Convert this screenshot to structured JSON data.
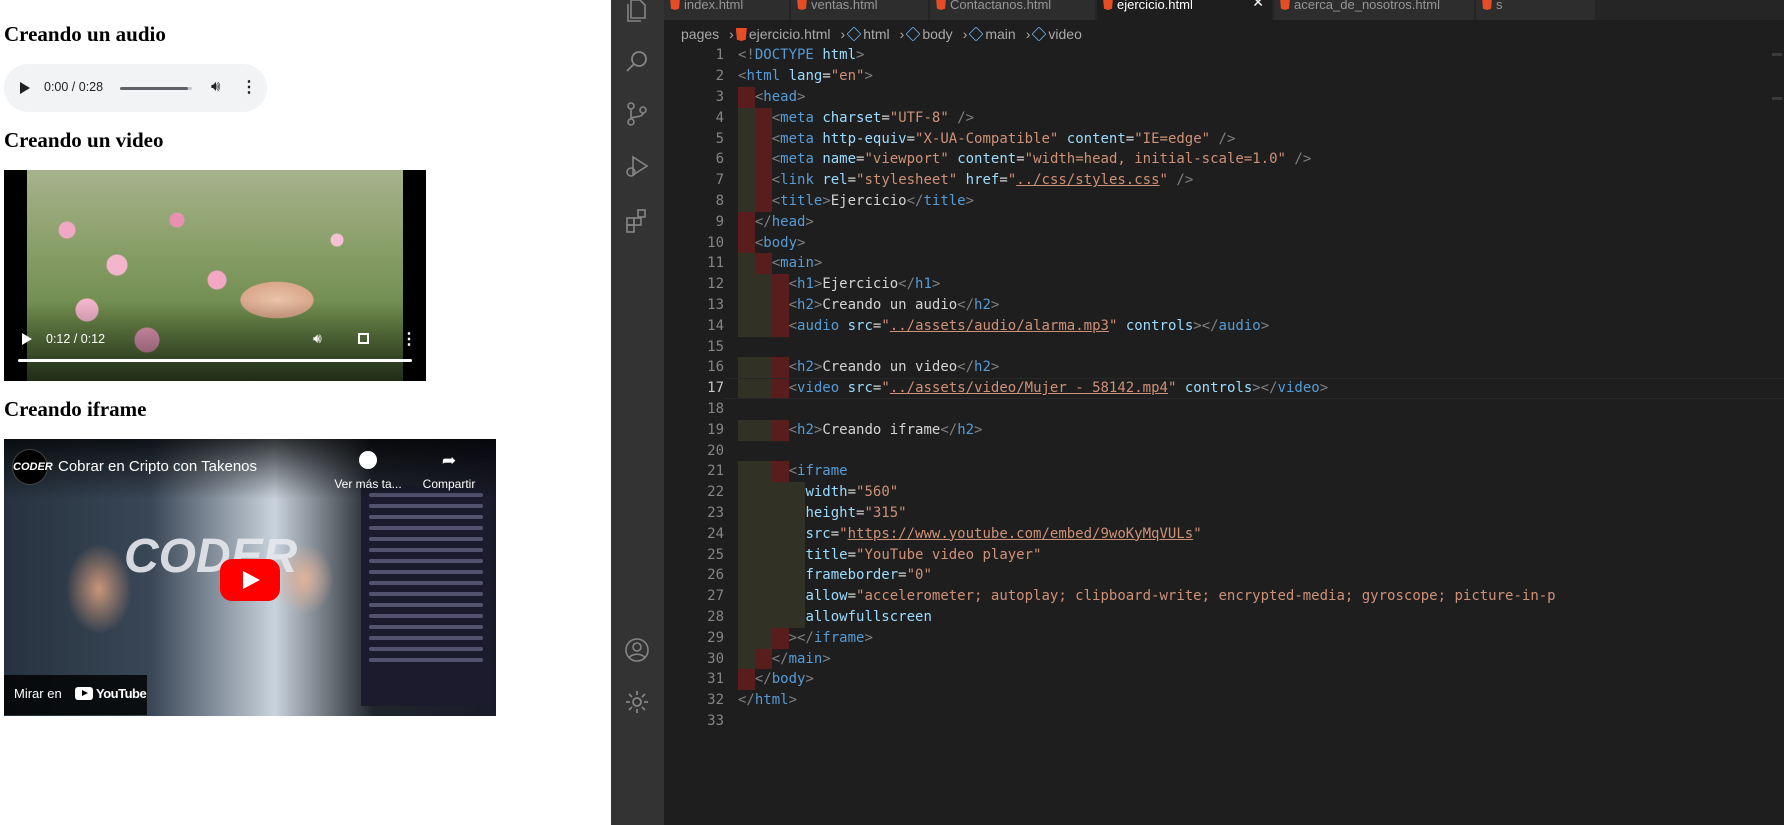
{
  "preview": {
    "audio_heading": "Creando un audio",
    "audio": {
      "time": "0:00 / 0:28",
      "progress": 0.95
    },
    "video_heading": "Creando un video",
    "video": {
      "time": "0:12 / 0:12",
      "progress": 1.0
    },
    "iframe_heading": "Creando iframe",
    "iframe": {
      "channel_logo": "CODER",
      "video_title": "Cobrar en Cripto con Takenos",
      "watch_later": "Ver más ta...",
      "share": "Compartir",
      "watch_on": "Mirar en",
      "youtube_label": "YouTube",
      "scene_text": "CODER"
    }
  },
  "editor": {
    "tabs": [
      {
        "label": "index.html",
        "active": false
      },
      {
        "label": "ventas.html",
        "active": false
      },
      {
        "label": "Contactanos.html",
        "active": false
      },
      {
        "label": "ejercicio.html",
        "active": true
      },
      {
        "label": "acerca_de_nosotros.html",
        "active": false
      },
      {
        "label": "s",
        "active": false
      }
    ],
    "breadcrumb": [
      "pages",
      "ejercicio.html",
      "html",
      "body",
      "main",
      "video"
    ],
    "current_line": 17,
    "lines": [
      [
        [
          "br",
          "<!"
        ],
        [
          "tag",
          "DOCTYPE"
        ],
        [
          "tx",
          " "
        ],
        [
          "at",
          "html"
        ],
        [
          "br",
          ">"
        ]
      ],
      [
        [
          "br",
          "<"
        ],
        [
          "tag",
          "html"
        ],
        [
          "tx",
          " "
        ],
        [
          "at",
          "lang"
        ],
        [
          "tx",
          "="
        ],
        [
          "sv",
          "\"en\""
        ],
        [
          "br",
          ">"
        ]
      ],
      [
        [
          "tx",
          "  "
        ],
        [
          "br",
          "<"
        ],
        [
          "tag",
          "head"
        ],
        [
          "br",
          ">"
        ]
      ],
      [
        [
          "tx",
          "    "
        ],
        [
          "br",
          "<"
        ],
        [
          "tag",
          "meta"
        ],
        [
          "tx",
          " "
        ],
        [
          "at",
          "charset"
        ],
        [
          "tx",
          "="
        ],
        [
          "sv",
          "\"UTF-8\""
        ],
        [
          "tx",
          " "
        ],
        [
          "br",
          "/>"
        ]
      ],
      [
        [
          "tx",
          "    "
        ],
        [
          "br",
          "<"
        ],
        [
          "tag",
          "meta"
        ],
        [
          "tx",
          " "
        ],
        [
          "at",
          "http-equiv"
        ],
        [
          "tx",
          "="
        ],
        [
          "sv",
          "\"X-UA-Compatible\""
        ],
        [
          "tx",
          " "
        ],
        [
          "at",
          "content"
        ],
        [
          "tx",
          "="
        ],
        [
          "sv",
          "\"IE=edge\""
        ],
        [
          "tx",
          " "
        ],
        [
          "br",
          "/>"
        ]
      ],
      [
        [
          "tx",
          "    "
        ],
        [
          "br",
          "<"
        ],
        [
          "tag",
          "meta"
        ],
        [
          "tx",
          " "
        ],
        [
          "at",
          "name"
        ],
        [
          "tx",
          "="
        ],
        [
          "sv",
          "\"viewport\""
        ],
        [
          "tx",
          " "
        ],
        [
          "at",
          "content"
        ],
        [
          "tx",
          "="
        ],
        [
          "sv",
          "\"width=head, initial-scale=1.0\""
        ],
        [
          "tx",
          " "
        ],
        [
          "br",
          "/>"
        ]
      ],
      [
        [
          "tx",
          "    "
        ],
        [
          "br",
          "<"
        ],
        [
          "tag",
          "link"
        ],
        [
          "tx",
          " "
        ],
        [
          "at",
          "rel"
        ],
        [
          "tx",
          "="
        ],
        [
          "sv",
          "\"stylesheet\""
        ],
        [
          "tx",
          " "
        ],
        [
          "at",
          "href"
        ],
        [
          "tx",
          "="
        ],
        [
          "sv",
          "\""
        ],
        [
          "svu",
          "../css/styles.css"
        ],
        [
          "sv",
          "\""
        ],
        [
          "tx",
          " "
        ],
        [
          "br",
          "/>"
        ]
      ],
      [
        [
          "tx",
          "    "
        ],
        [
          "br",
          "<"
        ],
        [
          "tag",
          "title"
        ],
        [
          "br",
          ">"
        ],
        [
          "tx",
          "Ejercicio"
        ],
        [
          "br",
          "</"
        ],
        [
          "tag",
          "title"
        ],
        [
          "br",
          ">"
        ]
      ],
      [
        [
          "tx",
          "  "
        ],
        [
          "br",
          "</"
        ],
        [
          "tag",
          "head"
        ],
        [
          "br",
          ">"
        ]
      ],
      [
        [
          "tx",
          "  "
        ],
        [
          "br",
          "<"
        ],
        [
          "tag",
          "body"
        ],
        [
          "br",
          ">"
        ]
      ],
      [
        [
          "tx",
          "    "
        ],
        [
          "br",
          "<"
        ],
        [
          "tag",
          "main"
        ],
        [
          "br",
          ">"
        ]
      ],
      [
        [
          "tx",
          "      "
        ],
        [
          "br",
          "<"
        ],
        [
          "tag",
          "h1"
        ],
        [
          "br",
          ">"
        ],
        [
          "tx",
          "Ejercicio"
        ],
        [
          "br",
          "</"
        ],
        [
          "tag",
          "h1"
        ],
        [
          "br",
          ">"
        ]
      ],
      [
        [
          "tx",
          "      "
        ],
        [
          "br",
          "<"
        ],
        [
          "tag",
          "h2"
        ],
        [
          "br",
          ">"
        ],
        [
          "tx",
          "Creando un audio"
        ],
        [
          "br",
          "</"
        ],
        [
          "tag",
          "h2"
        ],
        [
          "br",
          ">"
        ]
      ],
      [
        [
          "tx",
          "      "
        ],
        [
          "br",
          "<"
        ],
        [
          "tag",
          "audio"
        ],
        [
          "tx",
          " "
        ],
        [
          "at",
          "src"
        ],
        [
          "tx",
          "="
        ],
        [
          "sv",
          "\""
        ],
        [
          "svu",
          "../assets/audio/alarma.mp3"
        ],
        [
          "sv",
          "\""
        ],
        [
          "tx",
          " "
        ],
        [
          "at",
          "controls"
        ],
        [
          "br",
          "></"
        ],
        [
          "tag",
          "audio"
        ],
        [
          "br",
          ">"
        ]
      ],
      [],
      [
        [
          "tx",
          "      "
        ],
        [
          "br",
          "<"
        ],
        [
          "tag",
          "h2"
        ],
        [
          "br",
          ">"
        ],
        [
          "tx",
          "Creando un video"
        ],
        [
          "br",
          "</"
        ],
        [
          "tag",
          "h2"
        ],
        [
          "br",
          ">"
        ]
      ],
      [
        [
          "tx",
          "      "
        ],
        [
          "br",
          "<"
        ],
        [
          "tag",
          "video"
        ],
        [
          "tx",
          " "
        ],
        [
          "at",
          "src"
        ],
        [
          "tx",
          "="
        ],
        [
          "sv",
          "\""
        ],
        [
          "svu",
          "../assets/video/Mujer - 58142.mp4"
        ],
        [
          "sv",
          "\""
        ],
        [
          "tx",
          " "
        ],
        [
          "at",
          "controls"
        ],
        [
          "br",
          "></"
        ],
        [
          "tag",
          "video"
        ],
        [
          "br",
          ">"
        ]
      ],
      [],
      [
        [
          "tx",
          "      "
        ],
        [
          "br",
          "<"
        ],
        [
          "tag",
          "h2"
        ],
        [
          "br",
          ">"
        ],
        [
          "tx",
          "Creando iframe"
        ],
        [
          "br",
          "</"
        ],
        [
          "tag",
          "h2"
        ],
        [
          "br",
          ">"
        ]
      ],
      [],
      [
        [
          "tx",
          "      "
        ],
        [
          "br",
          "<"
        ],
        [
          "tag",
          "iframe"
        ]
      ],
      [
        [
          "tx",
          "        "
        ],
        [
          "at",
          "width"
        ],
        [
          "tx",
          "="
        ],
        [
          "sv",
          "\"560\""
        ]
      ],
      [
        [
          "tx",
          "        "
        ],
        [
          "at",
          "height"
        ],
        [
          "tx",
          "="
        ],
        [
          "sv",
          "\"315\""
        ]
      ],
      [
        [
          "tx",
          "        "
        ],
        [
          "at",
          "src"
        ],
        [
          "tx",
          "="
        ],
        [
          "sv",
          "\""
        ],
        [
          "svu",
          "https://www.youtube.com/embed/9woKyMqVULs"
        ],
        [
          "sv",
          "\""
        ]
      ],
      [
        [
          "tx",
          "        "
        ],
        [
          "at",
          "title"
        ],
        [
          "tx",
          "="
        ],
        [
          "sv",
          "\"YouTube video player\""
        ]
      ],
      [
        [
          "tx",
          "        "
        ],
        [
          "at",
          "frameborder"
        ],
        [
          "tx",
          "="
        ],
        [
          "sv",
          "\"0\""
        ]
      ],
      [
        [
          "tx",
          "        "
        ],
        [
          "at",
          "allow"
        ],
        [
          "tx",
          "="
        ],
        [
          "sv",
          "\"accelerometer; autoplay; clipboard-write; encrypted-media; gyroscope; picture-in-p"
        ]
      ],
      [
        [
          "tx",
          "        "
        ],
        [
          "at",
          "allowfullscreen"
        ]
      ],
      [
        [
          "tx",
          "      "
        ],
        [
          "br",
          "></"
        ],
        [
          "tag",
          "iframe"
        ],
        [
          "br",
          ">"
        ]
      ],
      [
        [
          "tx",
          "    "
        ],
        [
          "br",
          "</"
        ],
        [
          "tag",
          "main"
        ],
        [
          "br",
          ">"
        ]
      ],
      [
        [
          "tx",
          "  "
        ],
        [
          "br",
          "</"
        ],
        [
          "tag",
          "body"
        ],
        [
          "br",
          ">"
        ]
      ],
      [
        [
          "br",
          "</"
        ],
        [
          "tag",
          "html"
        ],
        [
          "br",
          ">"
        ]
      ],
      []
    ],
    "line_numbers": [
      "1",
      "2",
      "3",
      "4",
      "5",
      "6",
      "7",
      "8",
      "9",
      "10",
      "11",
      "12",
      "13",
      "14",
      "15",
      "16",
      "17",
      "18",
      "19",
      "20",
      "21",
      "22",
      "23",
      "24",
      "25",
      "26",
      "27",
      "28",
      "29",
      "30",
      "31",
      "32",
      "33"
    ]
  }
}
